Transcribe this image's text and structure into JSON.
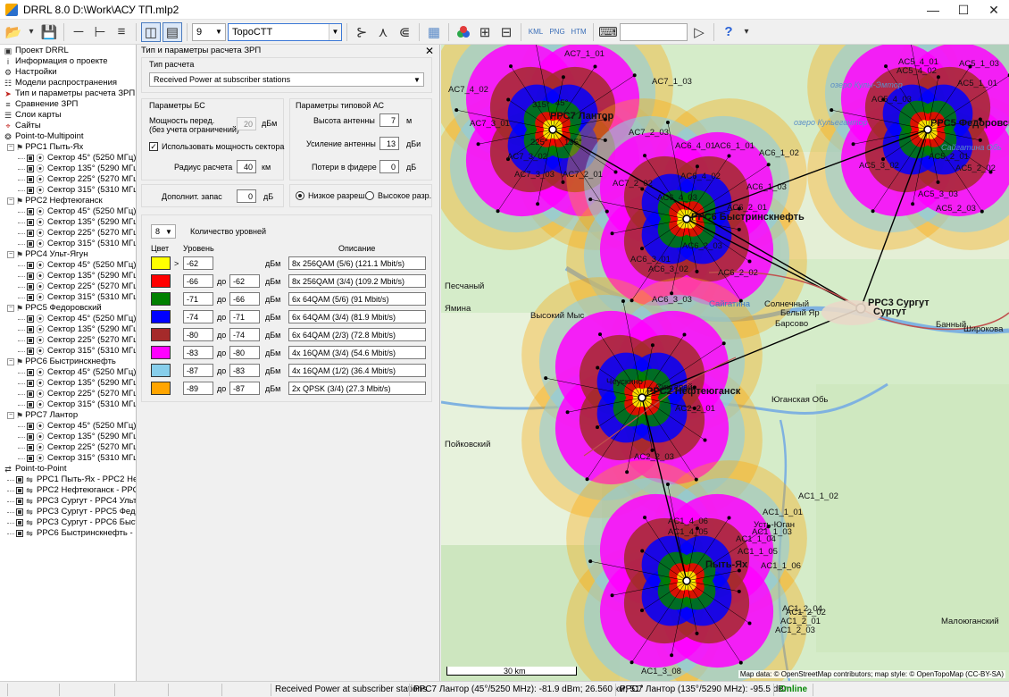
{
  "window": {
    "title": "DRRL 8.0 D:\\Work\\АСУ ТП.mlp2"
  },
  "toolbar": {
    "level_count": "9",
    "map_source": "TopoCTT",
    "search_value": ""
  },
  "tree": {
    "items": [
      {
        "label": "Проект DRRL",
        "icon": "project-icon",
        "depth": 0,
        "kind": "root"
      },
      {
        "label": "Информация о проекте",
        "icon": "info-icon",
        "depth": 0,
        "kind": "leaf"
      },
      {
        "label": "Настройки",
        "icon": "gear-icon",
        "depth": 0,
        "kind": "leaf"
      },
      {
        "label": "Модели распространения",
        "icon": "model-icon",
        "depth": 0,
        "kind": "leaf"
      },
      {
        "label": "Тип и параметры расчета ЗРП",
        "icon": "arrow-right-icon",
        "depth": 0,
        "kind": "leaf"
      },
      {
        "label": "Сравнение ЗРП",
        "icon": "compare-icon",
        "depth": 0,
        "kind": "leaf"
      },
      {
        "label": "Слои карты",
        "icon": "layers-icon",
        "depth": 0,
        "kind": "leaf"
      },
      {
        "label": "Сайты",
        "icon": "site-icon",
        "depth": 0,
        "kind": "leaf"
      },
      {
        "label": "Point-to-Multipoint",
        "icon": "ptmp-icon",
        "depth": 0,
        "kind": "group"
      },
      {
        "label": "PPC1 Пыть-Ях",
        "depth": 1,
        "kind": "station"
      },
      {
        "label": "Сектор 45° (5250 МГц)",
        "depth": 2,
        "kind": "sector"
      },
      {
        "label": "Сектор 135° (5290 МГц)",
        "depth": 2,
        "kind": "sector"
      },
      {
        "label": "Сектор 225° (5270 МГц)",
        "depth": 2,
        "kind": "sector"
      },
      {
        "label": "Сектор 315° (5310 МГц)",
        "depth": 2,
        "kind": "sector"
      },
      {
        "label": "PPC2 Нефтеюганск",
        "depth": 1,
        "kind": "station"
      },
      {
        "label": "Сектор 45° (5250 МГц)",
        "depth": 2,
        "kind": "sector"
      },
      {
        "label": "Сектор 135° (5290 МГц)",
        "depth": 2,
        "kind": "sector"
      },
      {
        "label": "Сектор 225° (5270 МГц)",
        "depth": 2,
        "kind": "sector"
      },
      {
        "label": "Сектор 315° (5310 МГц)",
        "depth": 2,
        "kind": "sector"
      },
      {
        "label": "PPC4 Ульт-Ягун",
        "depth": 1,
        "kind": "station"
      },
      {
        "label": "Сектор 45° (5250 МГц)",
        "depth": 2,
        "kind": "sector"
      },
      {
        "label": "Сектор 135° (5290 МГц)",
        "depth": 2,
        "kind": "sector"
      },
      {
        "label": "Сектор 225° (5270 МГц)",
        "depth": 2,
        "kind": "sector"
      },
      {
        "label": "Сектор 315° (5310 МГц)",
        "depth": 2,
        "kind": "sector"
      },
      {
        "label": "PPC5 Федоровский",
        "depth": 1,
        "kind": "station"
      },
      {
        "label": "Сектор 45° (5250 МГц)",
        "depth": 2,
        "kind": "sector"
      },
      {
        "label": "Сектор 135° (5290 МГц)",
        "depth": 2,
        "kind": "sector"
      },
      {
        "label": "Сектор 225° (5270 МГц)",
        "depth": 2,
        "kind": "sector"
      },
      {
        "label": "Сектор 315° (5310 МГц)",
        "depth": 2,
        "kind": "sector"
      },
      {
        "label": "PPC6 Быстринскнефть",
        "depth": 1,
        "kind": "station"
      },
      {
        "label": "Сектор 45° (5250 МГц)",
        "depth": 2,
        "kind": "sector"
      },
      {
        "label": "Сектор 135° (5290 МГц)",
        "depth": 2,
        "kind": "sector"
      },
      {
        "label": "Сектор 225° (5270 МГц)",
        "depth": 2,
        "kind": "sector"
      },
      {
        "label": "Сектор 315° (5310 МГц)",
        "depth": 2,
        "kind": "sector"
      },
      {
        "label": "PPC7 Лантор",
        "depth": 1,
        "kind": "station"
      },
      {
        "label": "Сектор 45° (5250 МГц)",
        "depth": 2,
        "kind": "sector"
      },
      {
        "label": "Сектор 135° (5290 МГц)",
        "depth": 2,
        "kind": "sector"
      },
      {
        "label": "Сектор 225° (5270 МГц)",
        "depth": 2,
        "kind": "sector"
      },
      {
        "label": "Сектор 315° (5310 МГц)",
        "depth": 2,
        "kind": "sector"
      },
      {
        "label": "Point-to-Point",
        "icon": "ptp-icon",
        "depth": 0,
        "kind": "group"
      },
      {
        "label": "PPC1 Пыть-Ях - PPC2 Нефт",
        "depth": 1,
        "kind": "link"
      },
      {
        "label": "PPC2 Нефтеюганск - PPC3",
        "depth": 1,
        "kind": "link"
      },
      {
        "label": "PPC3 Сургут - PPC4 Ульт-Яг",
        "depth": 1,
        "kind": "link"
      },
      {
        "label": "PPC3 Сургут - PPC5 Федор",
        "depth": 1,
        "kind": "link"
      },
      {
        "label": "PPC3 Сургут - PPC6 Быстри",
        "depth": 1,
        "kind": "link"
      },
      {
        "label": "PPC6 Быстринскнефть - PP",
        "depth": 1,
        "kind": "link"
      }
    ]
  },
  "params": {
    "header": "Тип и параметры расчета ЗРП",
    "calc_type_label": "Тип расчета",
    "calc_type_value": "Received Power at subscriber stations",
    "bs_title": "Параметры БС",
    "tx_power_label_1": "Мощность перед.",
    "tx_power_label_2": "(без учета ограничений)",
    "tx_power_value": "20",
    "tx_power_unit": "дБм",
    "use_sector_power_label": "Использовать мощность сектора",
    "radius_label": "Радиус расчета",
    "radius_value": "40",
    "radius_unit": "км",
    "as_title": "Параметры типовой АС",
    "ant_height_label": "Высота антенны",
    "ant_height_value": "7",
    "ant_height_unit": "м",
    "ant_gain_label": "Усиление антенны",
    "ant_gain_value": "13",
    "ant_gain_unit": "дБи",
    "feeder_loss_label": "Потери в фидере",
    "feeder_loss_value": "0",
    "feeder_loss_unit": "дБ",
    "margin_label": "Дополнит. запас",
    "margin_value": "0",
    "margin_unit": "дБ",
    "low_res_label": "Низкое разреш.",
    "high_res_label": "Высокое разр.",
    "levels_count": "8",
    "levels_count_label": "Количество уровней",
    "col_color": "Цвет",
    "col_level": "Уровень",
    "col_desc": "Описание",
    "to_label": "до",
    "gt_label": ">",
    "unit_dbm": "дБм",
    "levels": [
      {
        "color": "#ffff00",
        "from": "-62",
        "to": "",
        "desc": "8x 256QAM (5/6) (121.1 Mbit/s)"
      },
      {
        "color": "#ff0000",
        "from": "-66",
        "to": "-62",
        "desc": "8x 256QAM (3/4) (109.2 Mbit/s)"
      },
      {
        "color": "#008000",
        "from": "-71",
        "to": "-66",
        "desc": "6x 64QAM (5/6) (91 Mbit/s)"
      },
      {
        "color": "#0000ff",
        "from": "-74",
        "to": "-71",
        "desc": "6x 64QAM (3/4) (81.9 Mbit/s)"
      },
      {
        "color": "#a52a2a",
        "from": "-80",
        "to": "-74",
        "desc": "6x 64QAM (2/3) (72.8 Mbit/s)"
      },
      {
        "color": "#ff00ff",
        "from": "-83",
        "to": "-80",
        "desc": "4x 16QAM (3/4) (54.6 Mbit/s)"
      },
      {
        "color": "#87ceeb",
        "from": "-87",
        "to": "-83",
        "desc": "4x 16QAM (1/2) (36.4 Mbit/s)"
      },
      {
        "color": "#ffa500",
        "from": "-89",
        "to": "-87",
        "desc": "2x QPSK (3/4) (27.3 Mbit/s)"
      }
    ]
  },
  "map": {
    "stations": [
      {
        "label": "PPC7 Лантор"
      },
      {
        "label": "PPC5 Федоровский"
      },
      {
        "label": "PPC6 Быстринскнефть"
      },
      {
        "label": "PPC3 Сургут"
      },
      {
        "label": "PPC2 Нефтеюганск"
      },
      {
        "label": "Пыть-Ях"
      }
    ],
    "places": [
      {
        "label": "Сургут"
      },
      {
        "label": "Белый Яр"
      },
      {
        "label": "Барсово"
      },
      {
        "label": "Солнечный"
      },
      {
        "label": "Сайгатина"
      },
      {
        "label": "Высокий Мыс"
      },
      {
        "label": "Пойковский"
      },
      {
        "label": "Юганская Обь"
      },
      {
        "label": "Усть-Юган"
      },
      {
        "label": "Банный"
      },
      {
        "label": "Широкова"
      },
      {
        "label": "Малоюганский"
      },
      {
        "label": "Сингапай"
      },
      {
        "label": "Чеускино"
      },
      {
        "label": "Ямина"
      },
      {
        "label": "Песчаный"
      },
      {
        "label": "озеро Кулы-Эмтор"
      },
      {
        "label": "озеро Кульегантор"
      },
      {
        "label": "Сайгатина Обь"
      }
    ],
    "site_labels": [
      "AC7_1_01",
      "AC7_1_03",
      "AC7_4_02",
      "AC7_3_01",
      "AC7_3_02",
      "AC7_3_03",
      "AC7_2_01",
      "AC7_2_02",
      "AC7_2_03",
      "AC5_4_01",
      "AC5_4_02",
      "AC5_1_03",
      "AC5_1_01",
      "AC5_3_02",
      "AC5_2_01",
      "AC5_2_02",
      "AC5_3_03",
      "AC5_2_03",
      "AC5_4_03",
      "AC6_4_01",
      "AC6_1_01",
      "AC6_1_02",
      "AC6_1_03",
      "AC6_4_02",
      "AC6_4_03",
      "AC6_2_01",
      "AC6_2_03",
      "AC6_3_01",
      "AC6_3_02",
      "AC6_3_03",
      "AC6_2_02",
      "AC2_2_01",
      "AC2_2_03",
      "AC1_1_01",
      "AC1_1_02",
      "AC1_1_03",
      "AC1_1_04",
      "AC1_1_05",
      "AC1_1_06",
      "AC1_4_05",
      "AC1_4_06",
      "AC1_2_01",
      "AC1_2_02",
      "AC1_2_03",
      "AC1_2_04",
      "AC1_3_08"
    ],
    "scale_label": "30 km",
    "attribution": "Map data: © OpenStreetMap contributors; map style: © OpenTopoMap (CC-BY-SA)",
    "sector_labels": [
      "45°",
      "135°",
      "225°",
      "315°"
    ]
  },
  "status": {
    "calc_mode": "Received Power at subscriber stations",
    "cursor_info_1": "PPC7 Лантор (45°/5250 MHz): -81.9 dBm; 26.560 км; 51°",
    "cursor_info_2": "PPC7 Лантор (135°/5290 MHz): -95.5 dBm",
    "connection": "Online"
  }
}
